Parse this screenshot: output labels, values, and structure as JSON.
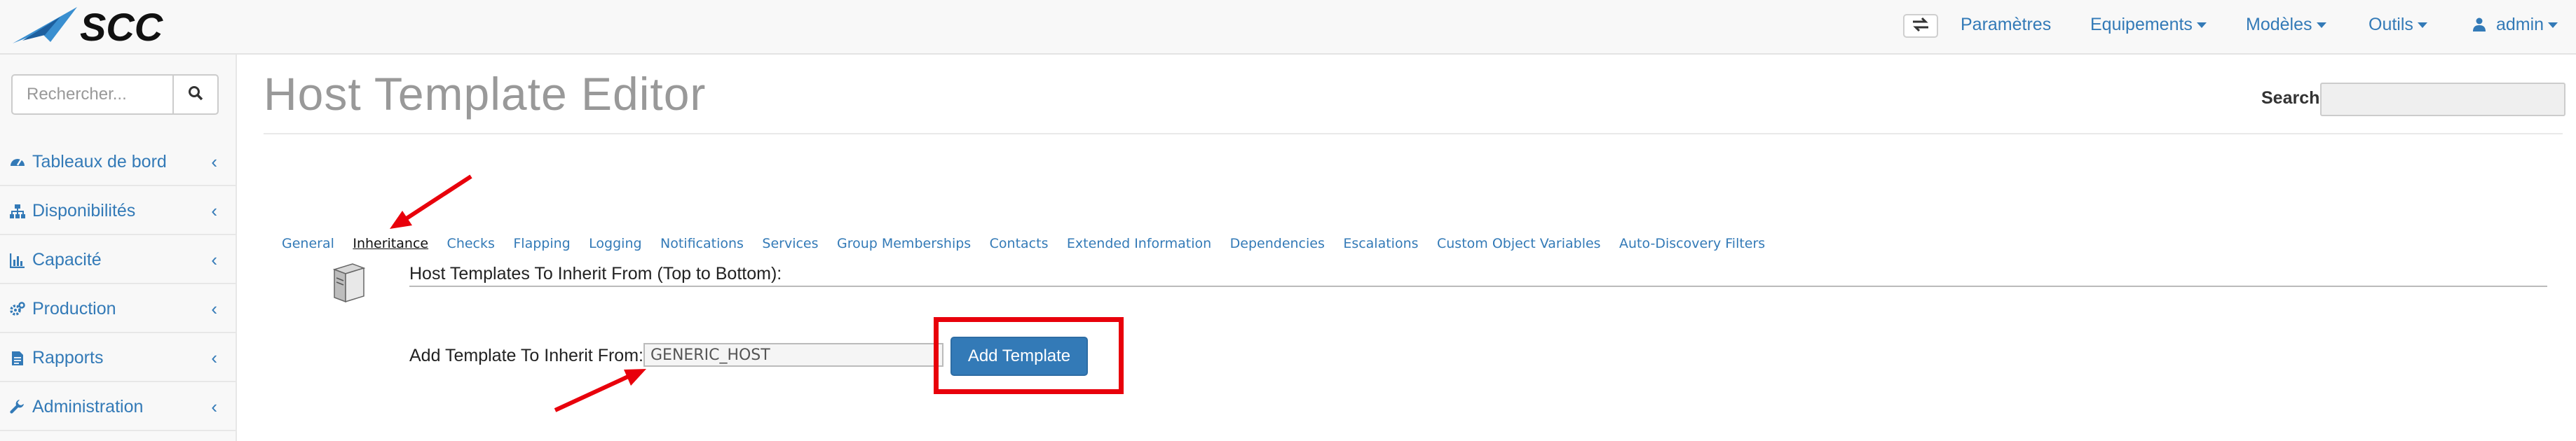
{
  "navbar": {
    "brand": "SCC",
    "items": [
      {
        "label": "Paramètres",
        "caret": false
      },
      {
        "label": "Equipements",
        "caret": true
      },
      {
        "label": "Modèles",
        "caret": true
      },
      {
        "label": "Outils",
        "caret": true
      },
      {
        "label": "admin",
        "caret": true
      }
    ],
    "toggle_icon": "exchange-icon",
    "user_icon": "user-icon"
  },
  "sidebar": {
    "search_placeholder": "Rechercher...",
    "search_icon": "search-icon",
    "items": [
      {
        "label": "Tableaux de bord",
        "icon": "tachometer-icon"
      },
      {
        "label": "Disponibilités",
        "icon": "sitemap-icon"
      },
      {
        "label": "Capacité",
        "icon": "bar-chart-icon"
      },
      {
        "label": "Production",
        "icon": "gears-icon"
      },
      {
        "label": "Rapports",
        "icon": "file-icon"
      },
      {
        "label": "Administration",
        "icon": "wrench-icon"
      }
    ],
    "chevron": "‹"
  },
  "main": {
    "title": "Host Template Editor",
    "search_label": "Search:",
    "search_value": "",
    "tabs": [
      {
        "label": "General"
      },
      {
        "label": "Inheritance",
        "active": true
      },
      {
        "label": "Checks"
      },
      {
        "label": "Flapping"
      },
      {
        "label": "Logging"
      },
      {
        "label": "Notifications"
      },
      {
        "label": "Services"
      },
      {
        "label": "Group Memberships"
      },
      {
        "label": "Contacts"
      },
      {
        "label": "Extended Information"
      },
      {
        "label": "Dependencies"
      },
      {
        "label": "Escalations"
      },
      {
        "label": "Custom Object Variables"
      },
      {
        "label": "Auto-Discovery Filters"
      }
    ],
    "section_label": "Host Templates To Inherit From (Top to Bottom):",
    "add_label": "Add Template To Inherit From:",
    "selected_template": "GENERIC_HOST",
    "add_button": "Add Template"
  },
  "colors": {
    "link": "#337ab7",
    "annotation": "#e8000b",
    "button": "#337ab7"
  }
}
